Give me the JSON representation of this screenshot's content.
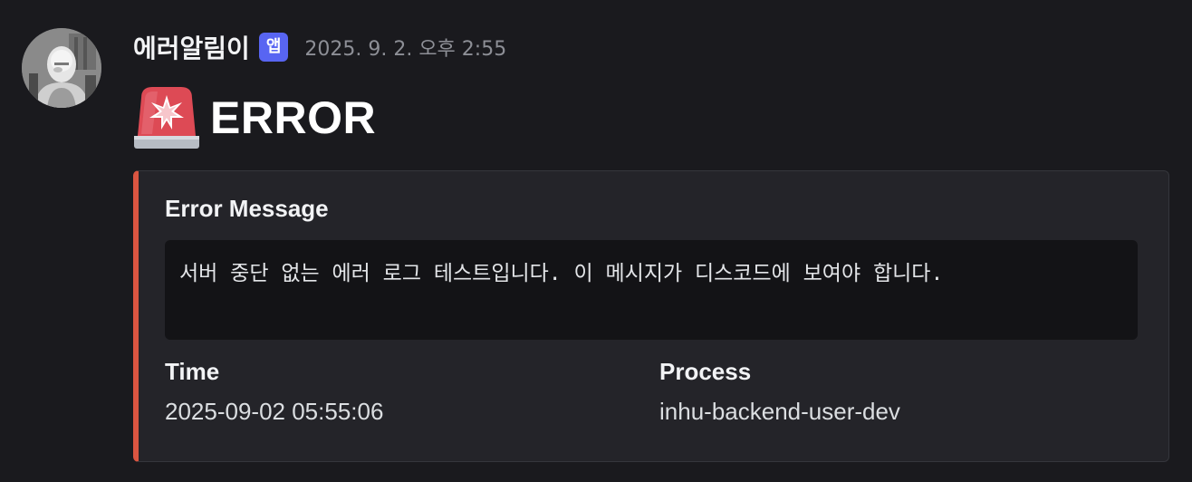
{
  "message": {
    "username": "에러알림이",
    "app_badge": "앱",
    "timestamp": "2025. 9. 2. 오후 2:55",
    "avatar_icon": "robot-avatar-icon",
    "title_icon": "police-car-light-icon",
    "title": "ERROR"
  },
  "embed": {
    "accent_color": "#da5541",
    "error_message_label": "Error Message",
    "error_message_value": "서버 중단 없는 에러 로그 테스트입니다. 이 메시지가 디스코드에 보여야 합니다.",
    "fields": [
      {
        "name": "Time",
        "value": "2025-09-02 05:55:06"
      },
      {
        "name": "Process",
        "value": "inhu-backend-user-dev"
      }
    ]
  },
  "colors": {
    "background": "#1a1a1e",
    "embed_background": "#242429",
    "badge": "#5865f2",
    "timestamp": "#8d8f96"
  }
}
